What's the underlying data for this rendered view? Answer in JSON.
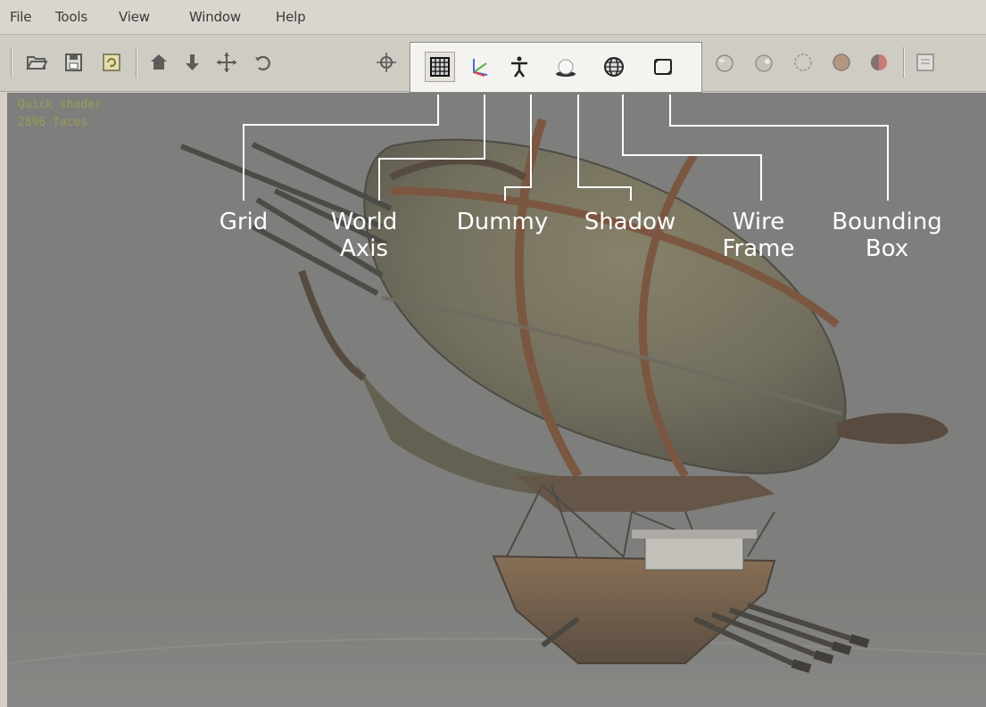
{
  "menu": {
    "items": [
      "File",
      "Tools",
      "View",
      "Window",
      "Help"
    ]
  },
  "toolbar": {
    "left_icons": [
      "open-folder-icon",
      "save-icon",
      "refresh-icon",
      "home-icon",
      "down-arrow-icon",
      "move-icon",
      "rotate-icon",
      "pan-icon"
    ],
    "highlighted_icons": [
      "grid-icon",
      "world-axis-icon",
      "dummy-icon",
      "shadow-icon",
      "wireframe-icon",
      "bounding-box-icon"
    ],
    "right_icons": [
      "sphere-smooth-icon",
      "sphere-light-icon",
      "sphere-outline-icon",
      "sphere-texture-icon",
      "sphere-red-icon",
      "panel-icon"
    ]
  },
  "viewport": {
    "status_line1": "Quick shader",
    "status_line2": "2896 faces"
  },
  "callouts": {
    "grid": [
      "Grid"
    ],
    "world_axis": [
      "World",
      "Axis"
    ],
    "dummy": [
      "Dummy"
    ],
    "shadow": [
      "Shadow"
    ],
    "wire_frame": [
      "Wire",
      "Frame"
    ],
    "bounding_box": [
      "Bounding",
      "Box"
    ]
  },
  "colors": {
    "viewport_bg": "#7e7e7c",
    "label_text": "#ffffff",
    "status_text": "#9a9c55",
    "leader_line": "#ffffff"
  }
}
